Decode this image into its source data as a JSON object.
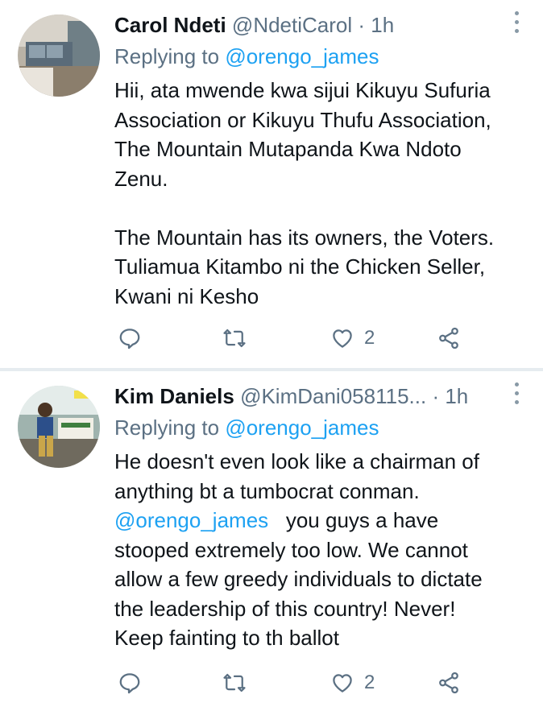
{
  "tweets": [
    {
      "name": "Carol Ndeti",
      "handle": "@NdetiCarol",
      "time": "· 1h",
      "replying_prefix": "Replying to ",
      "replying_to": "@orengo_james",
      "lines": [
        "Hii, ata mwende kwa sijui Kikuyu Sufuria",
        "Association or Kikuyu Thufu Association,",
        "The Mountain Mutapanda Kwa Ndoto",
        "Zenu.",
        "",
        "The Mountain has its owners, the Voters.",
        "Tuliamua Kitambo ni the Chicken Seller,",
        "Kwani ni Kesho"
      ],
      "like_count": "2"
    },
    {
      "name": "Kim Daniels",
      "handle": "@KimDani058115...",
      "time": "· 1h",
      "replying_prefix": "Replying to ",
      "replying_to": "@orengo_james",
      "line1": "He doesn't even look like a chairman of",
      "line2": "anything bt a tumbocrat conman.",
      "mention": "@orengo_james",
      "line3_rest": "you guys a have",
      "line4": "stooped extremely too low. We cannot",
      "line5": "allow a few greedy individuals to dictate",
      "line6": "the leadership of this country! Never!",
      "line7": "Keep fainting to th ballot",
      "like_count": "2"
    }
  ],
  "icons": [
    "reply-icon",
    "retweet-icon",
    "like-icon",
    "share-icon",
    "more-icon"
  ],
  "colors": {
    "link": "#1da1f2",
    "secondary": "#5b7083",
    "divider": "#e6ecf0"
  }
}
